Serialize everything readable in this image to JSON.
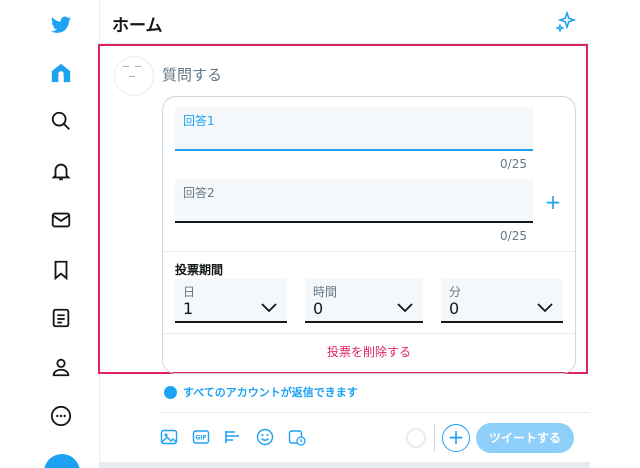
{
  "header": {
    "title": "ホーム"
  },
  "sidebar": {
    "items": [
      {
        "icon": "twitter-bird-icon"
      },
      {
        "icon": "home-icon"
      },
      {
        "icon": "search-icon"
      },
      {
        "icon": "bell-icon"
      },
      {
        "icon": "mail-icon"
      },
      {
        "icon": "bookmark-icon"
      },
      {
        "icon": "list-icon"
      },
      {
        "icon": "profile-icon"
      },
      {
        "icon": "more-icon"
      }
    ]
  },
  "compose": {
    "placeholder": "質問する",
    "poll": {
      "choices": [
        {
          "label": "回答1",
          "counter": "0/25"
        },
        {
          "label": "回答2",
          "counter": "0/25"
        }
      ],
      "add_choice": "+",
      "period_label": "投票期間",
      "period": [
        {
          "label": "日",
          "value": "1"
        },
        {
          "label": "時間",
          "value": "0"
        },
        {
          "label": "分",
          "value": "0"
        }
      ],
      "delete_label": "投票を削除する"
    },
    "reply_setting": "すべてのアカウントが返信できます",
    "tweet_label": "ツイートする",
    "add_label": "+"
  },
  "colors": {
    "accent": "#1da1f2",
    "danger": "#e0245e",
    "tweet_disabled": "#8ed0f9"
  }
}
